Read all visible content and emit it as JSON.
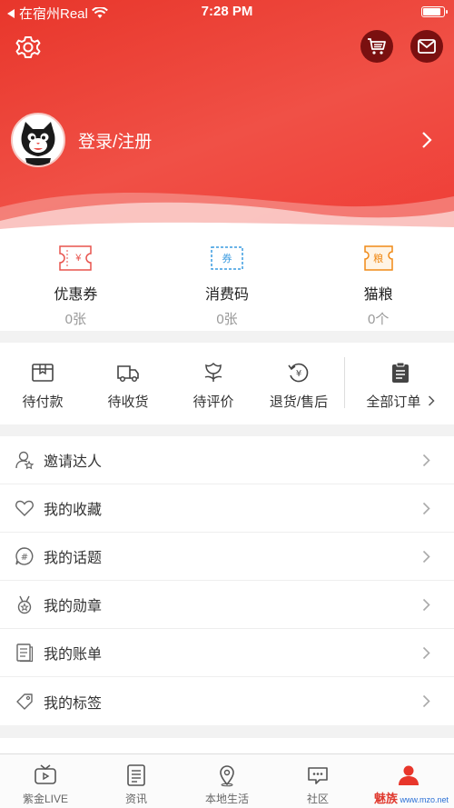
{
  "status": {
    "carrier": "在宿州Real",
    "time": "7:28 PM"
  },
  "profile": {
    "login_text": "登录/注册"
  },
  "coupons": [
    {
      "label": "优惠券",
      "count": "0张",
      "icon_text": "¥",
      "color": "#e8534d"
    },
    {
      "label": "消费码",
      "count": "0张",
      "icon_text": "券",
      "color": "#3a9be0"
    },
    {
      "label": "猫粮",
      "count": "0个",
      "icon_text": "粮",
      "color": "#f08a17"
    }
  ],
  "orders": [
    {
      "label": "待付款",
      "icon": "wallet-icon"
    },
    {
      "label": "待收货",
      "icon": "truck-icon"
    },
    {
      "label": "待评价",
      "icon": "flower-icon"
    },
    {
      "label": "退货/售后",
      "icon": "refund-icon"
    },
    {
      "label": "全部订单",
      "icon": "clipboard-icon"
    }
  ],
  "menu": [
    {
      "label": "邀请达人",
      "icon": "invite-icon"
    },
    {
      "label": "我的收藏",
      "icon": "heart-icon"
    },
    {
      "label": "我的话题",
      "icon": "topic-icon"
    },
    {
      "label": "我的勋章",
      "icon": "medal-icon"
    },
    {
      "label": "我的账单",
      "icon": "bill-icon"
    },
    {
      "label": "我的标签",
      "icon": "tag-icon"
    }
  ],
  "tabs": [
    {
      "label": "紫金LIVE",
      "icon": "tv-icon"
    },
    {
      "label": "资讯",
      "icon": "news-icon"
    },
    {
      "label": "本地生活",
      "icon": "location-icon"
    },
    {
      "label": "社区",
      "icon": "chat-icon"
    },
    {
      "label": "",
      "icon": "user-icon",
      "active": true
    }
  ],
  "watermark": {
    "brand": "魅族",
    "site": "www.mzo.net"
  },
  "colors": {
    "primary": "#e8362b",
    "avatar_btn": "#7a1010"
  }
}
